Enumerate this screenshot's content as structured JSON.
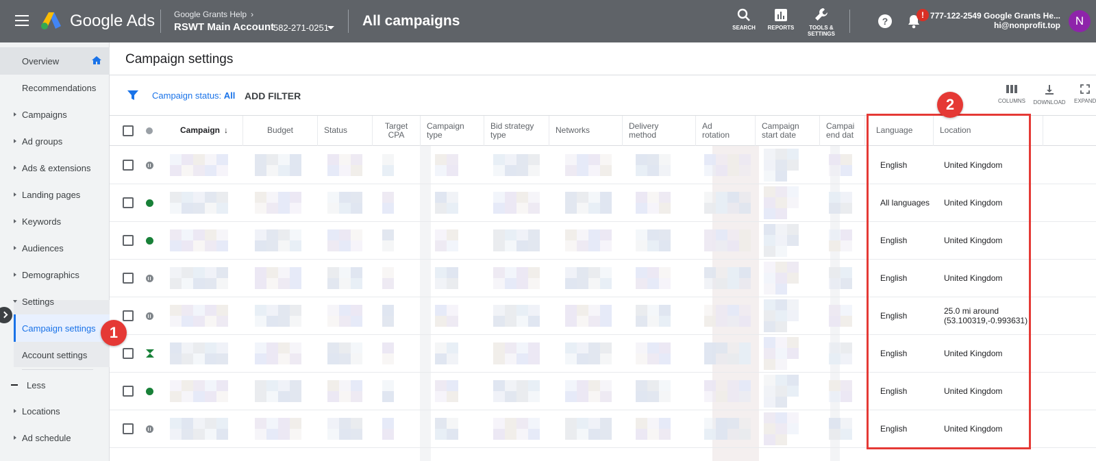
{
  "header": {
    "brand": "Google Ads",
    "breadcrumb_parent": "Google Grants Help",
    "account_name": "RSWT Main Account",
    "account_id": "582-271-0251",
    "page_heading": "All campaigns",
    "tools": [
      {
        "label": "SEARCH",
        "icon": "search-icon"
      },
      {
        "label": "REPORTS",
        "icon": "reports-icon"
      },
      {
        "label_line1": "TOOLS &",
        "label_line2": "SETTINGS",
        "icon": "wrench-icon"
      }
    ],
    "notification_badge": "!",
    "account_line1": "777-122-2549 Google Grants He...",
    "account_line2": "hi@nonprofit.top",
    "avatar_letter": "N",
    "avatar_color": "#8e24aa"
  },
  "sidebar": {
    "items": [
      {
        "label": "Overview"
      },
      {
        "label": "Recommendations"
      },
      {
        "label": "Campaigns"
      },
      {
        "label": "Ad groups"
      },
      {
        "label": "Ads & extensions"
      },
      {
        "label": "Landing pages"
      },
      {
        "label": "Keywords"
      },
      {
        "label": "Audiences"
      },
      {
        "label": "Demographics"
      },
      {
        "label": "Settings"
      },
      {
        "label": "Campaign settings"
      },
      {
        "label": "Account settings"
      },
      {
        "label": "Less"
      },
      {
        "label": "Locations"
      },
      {
        "label": "Ad schedule"
      }
    ]
  },
  "main": {
    "title": "Campaign settings",
    "filter": {
      "prefix": "Campaign status: ",
      "value": "All"
    },
    "add_filter": "ADD FILTER",
    "actions": [
      {
        "label": "COLUMNS",
        "icon": "columns-icon"
      },
      {
        "label": "DOWNLOAD",
        "icon": "download-icon"
      },
      {
        "label": "EXPAND",
        "icon": "expand-icon"
      }
    ]
  },
  "table": {
    "columns": [
      {
        "label": "Campaign"
      },
      {
        "label": "Budget"
      },
      {
        "label": "Status"
      },
      {
        "line1": "Target",
        "line2": "CPA"
      },
      {
        "line1": "Campaign",
        "line2": "type"
      },
      {
        "line1": "Bid strategy",
        "line2": "type"
      },
      {
        "label": "Networks"
      },
      {
        "line1": "Delivery",
        "line2": "method"
      },
      {
        "line1": "Ad",
        "line2": "rotation"
      },
      {
        "line1": "Campaign",
        "line2": "start date"
      },
      {
        "line1": "Campai",
        "line2": "end dat"
      },
      {
        "label": "Language"
      },
      {
        "label": "Location"
      }
    ],
    "rows": [
      {
        "status": "paused",
        "language": "English",
        "location": "United Kingdom"
      },
      {
        "status": "enabled",
        "language": "All languages",
        "location": "United Kingdom"
      },
      {
        "status": "enabled",
        "language": "English",
        "location": "United Kingdom"
      },
      {
        "status": "paused",
        "language": "English",
        "location": "United Kingdom"
      },
      {
        "status": "paused",
        "language": "English",
        "location": "25.0 mi around (53.100319,-0.993631)"
      },
      {
        "status": "pending",
        "language": "English",
        "location": "United Kingdom"
      },
      {
        "status": "enabled",
        "language": "English",
        "location": "United Kingdom"
      },
      {
        "status": "paused",
        "language": "English",
        "location": "United Kingdom"
      }
    ]
  },
  "annotations": {
    "badge1": "1",
    "badge2": "2",
    "color": "#e53935"
  }
}
